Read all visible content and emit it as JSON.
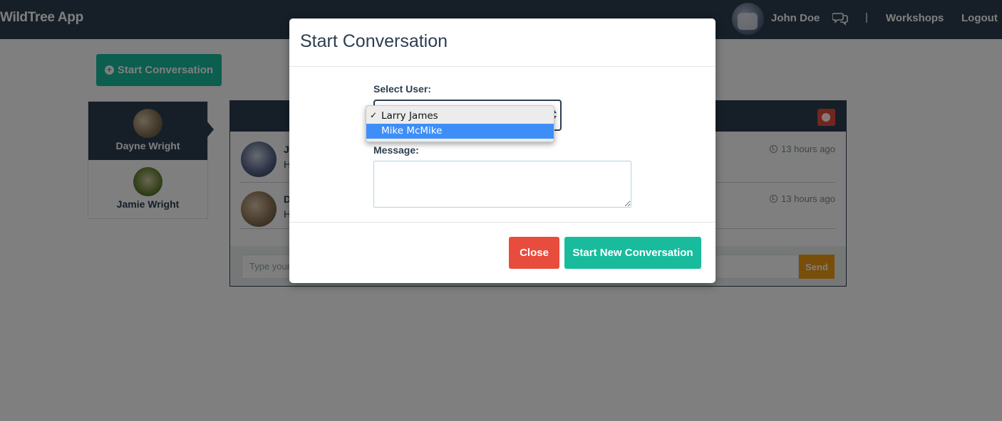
{
  "navbar": {
    "brand": "WildTree App",
    "user_name": "John Doe",
    "separator": "|",
    "workshops": "Workshops",
    "logout": "Logout"
  },
  "page": {
    "start_button_label": "Start Conversation",
    "conversations": [
      {
        "name": "Dayne Wright",
        "active": true
      },
      {
        "name": "Jamie Wright",
        "active": false
      }
    ],
    "messages": [
      {
        "sender": "J",
        "snippet": "H",
        "time": "13 hours ago"
      },
      {
        "sender": "D",
        "snippet": "H",
        "time": "13 hours ago"
      }
    ],
    "message_input_placeholder": "Type your",
    "send_label": "Send"
  },
  "modal": {
    "title": "Start Conversation",
    "select_user_label": "Select User:",
    "select_options": [
      {
        "label": "Larry James",
        "checked": true,
        "highlighted": false
      },
      {
        "label": "Mike McMike",
        "checked": false,
        "highlighted": true
      }
    ],
    "check_mark": "✓",
    "message_label": "Message:",
    "message_value": "",
    "close_label": "Close",
    "start_new_label": "Start New Conversation"
  },
  "colors": {
    "navbar": "#2c3e50",
    "primary": "#18bc9c",
    "danger": "#e74c3c",
    "warning": "#f39c12",
    "highlight": "#3e8ef7"
  },
  "icons": {
    "start_button": "plus-circle-icon",
    "navbar_chat": "comments-icon",
    "conversation_remove": "minus-circle-icon",
    "message_time": "clock-icon"
  }
}
